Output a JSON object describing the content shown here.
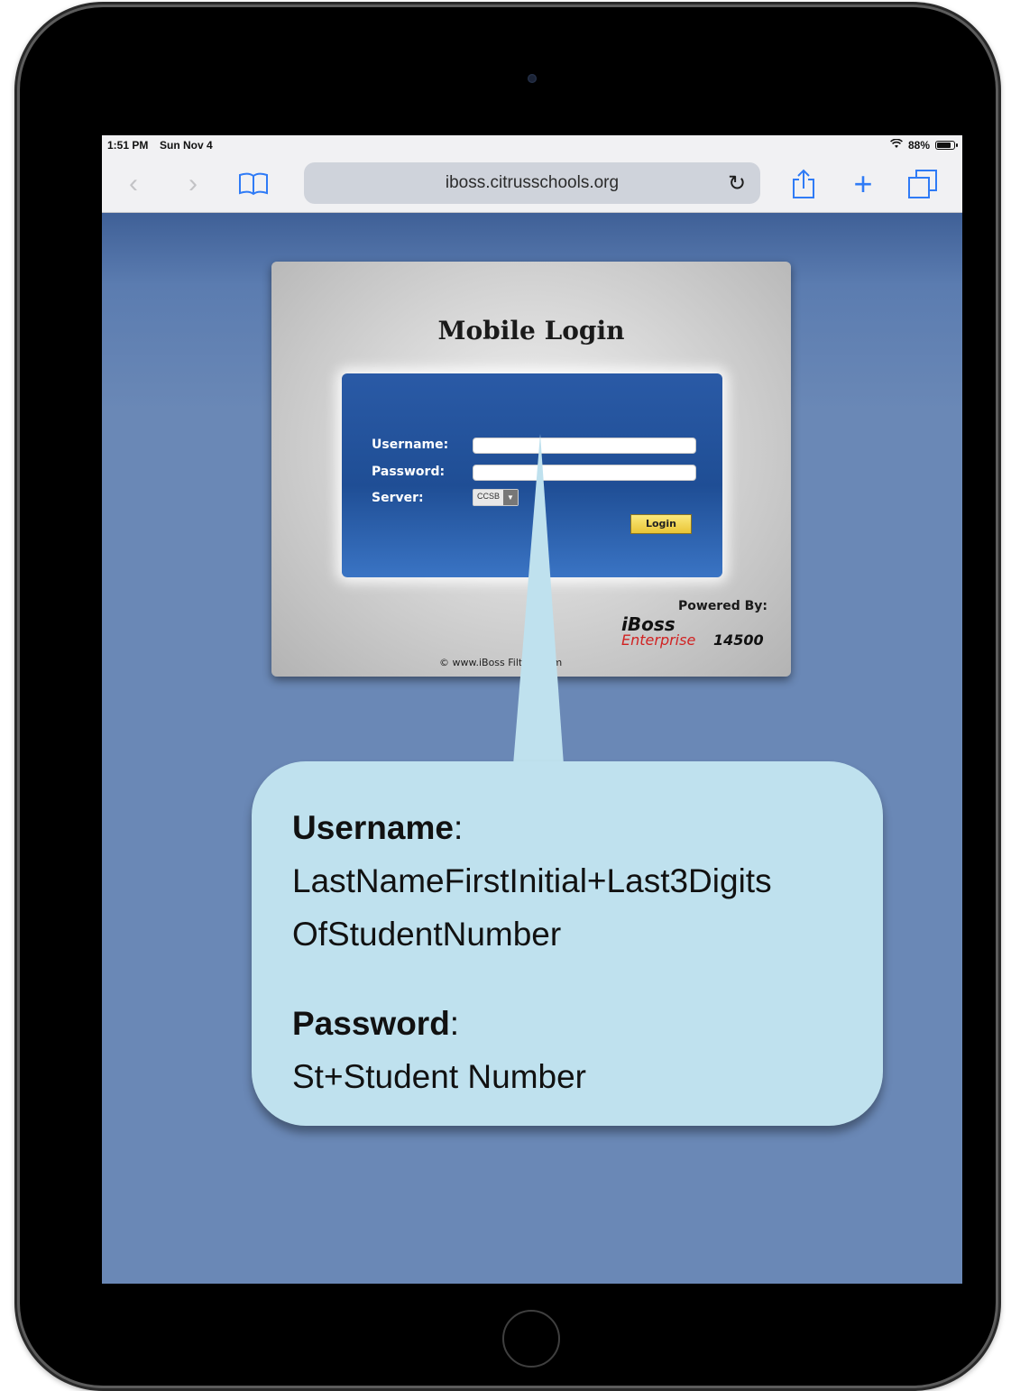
{
  "status_bar": {
    "time": "1:51 PM",
    "date": "Sun Nov 4",
    "battery": "88%"
  },
  "browser": {
    "url": "iboss.citrusschools.org"
  },
  "login": {
    "title": "Mobile Login",
    "username_label": "Username:",
    "password_label": "Password:",
    "server_label": "Server:",
    "server_value": "CCSB",
    "login_button": "Login",
    "powered_by": "Powered By:",
    "logo_brand": "iBoss",
    "logo_edition": "Enterprise",
    "logo_model": "14500",
    "copyright": "© www.iBoss    Filters.com"
  },
  "callout": {
    "username_heading": "Username",
    "username_colon": ":",
    "username_line1": "LastNameFirstInitial+Last3Digits",
    "username_line2": "OfStudentNumber",
    "password_heading": "Password",
    "password_colon": ":",
    "password_line": "St+Student Number",
    "background_color": "#bfe1ee"
  }
}
